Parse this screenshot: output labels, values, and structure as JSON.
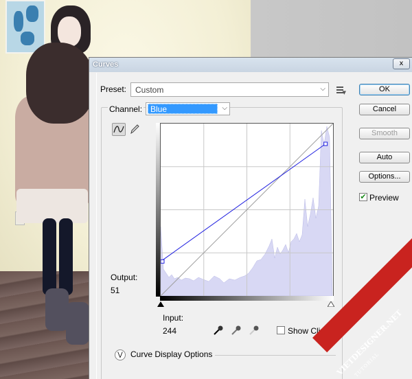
{
  "dialog": {
    "title": "Curves",
    "close_label": "x"
  },
  "preset": {
    "label": "Preset:",
    "value": "Custom"
  },
  "channel": {
    "label": "Channel:",
    "value": "Blue"
  },
  "buttons": {
    "ok": "OK",
    "cancel": "Cancel",
    "smooth": "Smooth",
    "auto": "Auto",
    "options": "Options..."
  },
  "preview": {
    "label": "Preview",
    "checked": true
  },
  "output": {
    "label": "Output:",
    "value": "51"
  },
  "input": {
    "label": "Input:",
    "value": "244"
  },
  "show_clipping": {
    "label": "Show Clipping",
    "checked": false
  },
  "curve_display_options": {
    "label": "Curve Display Options"
  },
  "curve": {
    "points": [
      [
        0,
        51
      ],
      [
        244,
        225
      ]
    ]
  },
  "icons": [
    "curve-tool-icon",
    "pencil-icon",
    "preset-menu-icon",
    "black-point-eyedropper-icon",
    "gray-point-eyedropper-icon",
    "white-point-eyedropper-icon",
    "black-slider-icon",
    "white-slider-icon",
    "expand-chevron-icon"
  ],
  "watermark": {
    "text": "VIETDESIGNER.NET",
    "subtext": "TUTORIAL"
  }
}
